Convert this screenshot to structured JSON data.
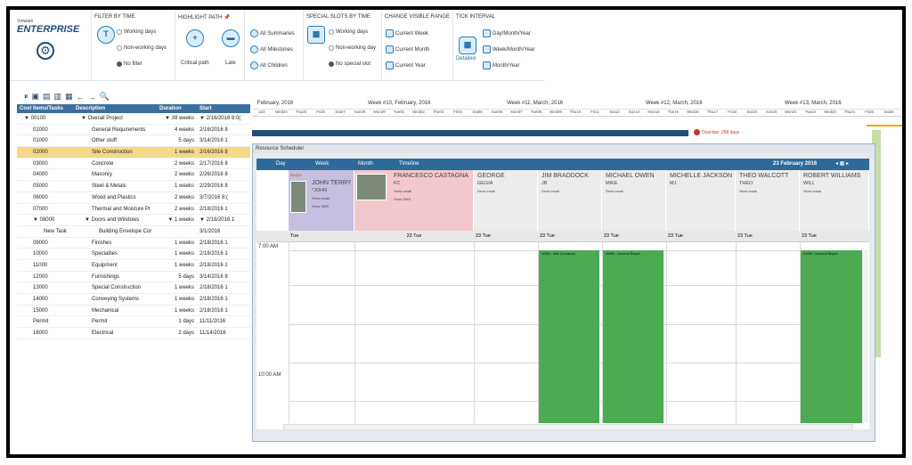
{
  "app": {
    "brand_small": "Vmware",
    "brand": "ENTERPRISE"
  },
  "ribbon": {
    "filter_by_time": {
      "title": "FILTER BY TIME",
      "working_days": "Working days",
      "non_working_days": "Non-working days",
      "no_filter": "No filter"
    },
    "highlight_path": {
      "title": "HIGHLIGHT PATH",
      "critical_path": "Critical path",
      "late": "Late"
    },
    "summaries": {
      "all_summaries": "All Summaries",
      "all_milestones": "All Milestones",
      "all_children": "All Children"
    },
    "special_slots": {
      "title": "SPECIAL SLOTS BY TIME",
      "working_days": "Working days",
      "non_working_day": "Non-working day",
      "no_special_slot": "No special slot"
    },
    "visible_range": {
      "title": "CHANGE VISIBLE RANGE",
      "current_week": "Current Week",
      "current_month": "Current Month",
      "current_year": "Current Year"
    },
    "tick_interval": {
      "title": "TICK INTERVAL",
      "detailed": "Detailed",
      "day_month_year": "Day/Month/Year",
      "week_month_year": "Week/Month/Year",
      "month_year": "Month/Year"
    }
  },
  "grid": {
    "columns": [
      "Cost Items/Tasks",
      "Description",
      "Duration",
      "Start"
    ],
    "rows": [
      {
        "code": "▼ 00100",
        "desc": "▼ Overall Project",
        "dur": "▼ 39 weeks",
        "start": "▼ 2/16/2016 8:0("
      },
      {
        "code": "01000",
        "desc": "General Requirements",
        "dur": "4 weeks",
        "start": "2/16/2016 8"
      },
      {
        "code": "01000",
        "desc": "Other stuff",
        "dur": "5 days",
        "start": "3/14/2016 1"
      },
      {
        "code": "02000",
        "desc": "Site Construction",
        "dur": "1 weeks",
        "start": "2/16/2016 8"
      },
      {
        "code": "03000",
        "desc": "Concrete",
        "dur": "2 weeks",
        "start": "2/17/2016 8"
      },
      {
        "code": "04000",
        "desc": "Masonry",
        "dur": "2 weeks",
        "start": "2/26/2016 8"
      },
      {
        "code": "05000",
        "desc": "Steel & Metals",
        "dur": "1 weeks",
        "start": "2/29/2016 8"
      },
      {
        "code": "06000",
        "desc": "Wood and Plastics",
        "dur": "2 weeks",
        "start": "3/7/2016 8:("
      },
      {
        "code": "07000",
        "desc": "Thermal and Moisture Pr",
        "dur": "2 weeks",
        "start": "2/18/2016 1"
      },
      {
        "code": "▼ 08000",
        "desc": "▼ Doors and Windows",
        "dur": "▼ 1 weeks",
        "start": "▼ 2/18/2016 1"
      },
      {
        "code": "New Task",
        "desc": "Building Envelope Cor",
        "dur": "",
        "start": "3/1/2016"
      },
      {
        "code": "09000",
        "desc": "Finishes",
        "dur": "1 weeks",
        "start": "2/18/2016 1"
      },
      {
        "code": "10000",
        "desc": "Specialties",
        "dur": "1 weeks",
        "start": "2/18/2016 1"
      },
      {
        "code": "11000",
        "desc": "Equipment",
        "dur": "1 weeks",
        "start": "2/18/2016 1"
      },
      {
        "code": "12000",
        "desc": "Furnishings",
        "dur": "5 days",
        "start": "3/14/2016 8"
      },
      {
        "code": "13000",
        "desc": "Special Construction",
        "dur": "1 weeks",
        "start": "2/18/2016 1"
      },
      {
        "code": "14000",
        "desc": "Conveying Systems",
        "dur": "1 weeks",
        "start": "2/18/2016 1"
      },
      {
        "code": "15000",
        "desc": "Mechanical",
        "dur": "1 weeks",
        "start": "2/18/2016 1"
      },
      {
        "code": "Permit",
        "desc": "Permit",
        "dur": "1 days",
        "start": "11/11/2016"
      },
      {
        "code": "16000",
        "desc": "Electrical",
        "dur": "2 days",
        "start": "11/14/2016"
      }
    ]
  },
  "gantt": {
    "months": [
      "February, 2016",
      "Week #10, February, 2016",
      "Week #11, March, 2016",
      "Week #12, March, 2016",
      "Week #13, March, 2016"
    ],
    "days": [
      "a23",
      "Wed24",
      "Thu25",
      "Fri26",
      "Sat27",
      "Sun28",
      "Mon29",
      "Tue01",
      "Wed02",
      "Thu03",
      "Fri04",
      "Sat05",
      "Sun06",
      "Mon07",
      "Tue08",
      "Wed09",
      "Thu10",
      "Fri11",
      "Sat12",
      "Sun13",
      "Mon14",
      "Tue15",
      "Wed16",
      "Thu17",
      "Fri18",
      "Sat19",
      "Sun20",
      "Mon21",
      "Tue22",
      "Wed23",
      "Thu24",
      "Fri25",
      "Sat26"
    ],
    "overdue": "Overdue: 258 days"
  },
  "scheduler": {
    "title": "Resource Scheduler",
    "tabs": [
      "Day",
      "Week",
      "Month",
      "Timeline"
    ],
    "date": "23 February 2016",
    "resources": [
      {
        "name": "JOHN TERRY",
        "sub": "*JOHN",
        "badge": "Badge",
        "email": "Send email",
        "sms": "Send SMS"
      },
      {
        "name": "FRANCESCO CASTAGNA",
        "sub": "FC",
        "email": "Send email",
        "sms": "Send SMS"
      },
      {
        "name": "GEORGE",
        "sub": "GEGIA",
        "email": "Send email"
      },
      {
        "name": "JIM BRADDOCK",
        "sub": "JB",
        "email": "Send email"
      },
      {
        "name": "MICHAEL OWEN",
        "sub": "MIKE",
        "email": "Send email"
      },
      {
        "name": "MICHELLE JACKSON",
        "sub": "MJ"
      },
      {
        "name": "THEO WALCOTT",
        "sub": "THEO",
        "email": "Send email"
      },
      {
        "name": "ROBERT WILLIAMS",
        "sub": "WILL",
        "email": "Send email"
      }
    ],
    "day_labels": [
      "Tue",
      "23 Tue",
      "23 Tue",
      "23 Tue",
      "23 Tue",
      "23 Tue",
      "23 Tue",
      "23 Tue"
    ],
    "times": [
      "7:00 AM",
      "10:00 AM"
    ],
    "appointments": [
      "02000 - Site Construct",
      "09000 - General Requir",
      "01000 - General Requir"
    ]
  }
}
